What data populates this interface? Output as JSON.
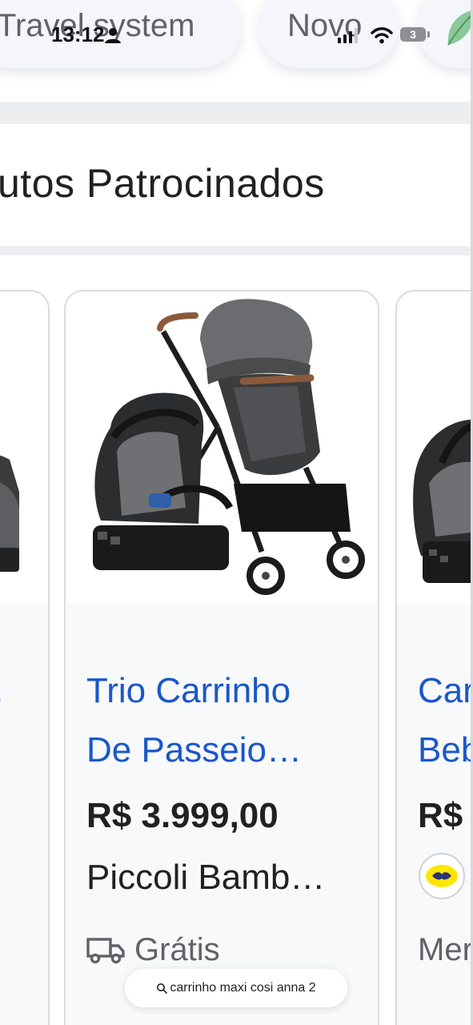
{
  "status_bar": {
    "time": "13:12",
    "battery_level": "3"
  },
  "chips": [
    {
      "label": "Travel system"
    },
    {
      "label": "Novo"
    }
  ],
  "section": {
    "title": "utos Patrocinados"
  },
  "products": [
    {
      "title_line1": "",
      "title_line2": ".",
      "price": "",
      "seller": "",
      "shipping": ""
    },
    {
      "title_line1": "Trio Carrinho",
      "title_line2": "De Passeio…",
      "price": "R$ 3.999,00",
      "seller": "Piccoli Bamb…",
      "shipping": "Grátis"
    },
    {
      "title_line1": "Car",
      "title_line2": "Beb",
      "price": "R$",
      "seller": "",
      "shipping": "Mer"
    }
  ],
  "search_bar": {
    "query": "carrinho maxi cosi anna 2"
  },
  "icons": {
    "person": "person-icon",
    "signal": "signal-icon",
    "wifi": "wifi-icon",
    "battery": "battery-icon",
    "truck": "truck-icon",
    "search": "search-icon",
    "seller_logo": "seller-logo-icon"
  },
  "colors": {
    "link_blue": "#1a57c9",
    "text_dark": "#202124",
    "text_gray": "#5f6368",
    "card_border": "#dadce0",
    "card_bg": "#f8f9fa"
  }
}
